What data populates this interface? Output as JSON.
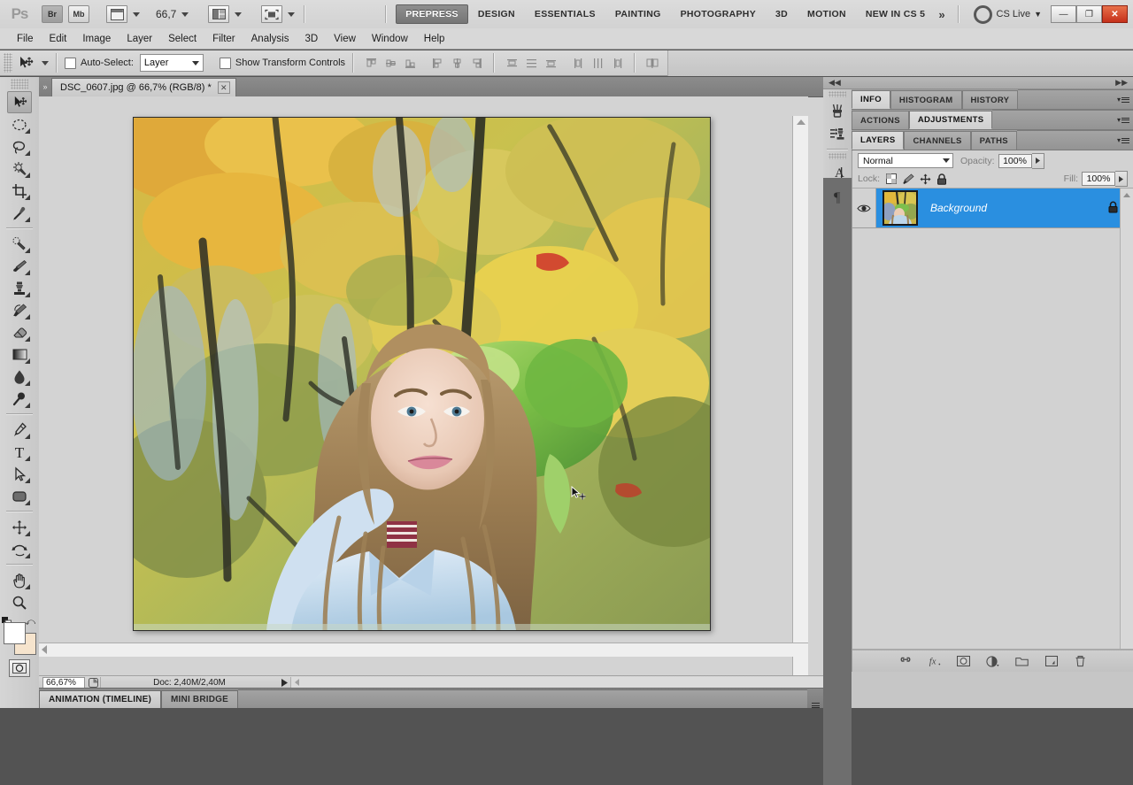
{
  "app": {
    "name": "Ps",
    "zoom_level": "66,7",
    "cs_live_label": "CS Live",
    "window_buttons": {
      "minimize": "—",
      "restore": "❐",
      "close": "✕"
    },
    "launchers": [
      {
        "name": "bridge-button",
        "label": "Br"
      },
      {
        "name": "mini-bridge-button",
        "label": "Mb"
      }
    ],
    "workspaces": [
      {
        "label": "PREPRESS",
        "active": true
      },
      {
        "label": "DESIGN",
        "active": false
      },
      {
        "label": "ESSENTIALS",
        "active": false
      },
      {
        "label": "PAINTING",
        "active": false
      },
      {
        "label": "PHOTOGRAPHY",
        "active": false
      },
      {
        "label": "3D",
        "active": false
      },
      {
        "label": "MOTION",
        "active": false
      },
      {
        "label": "NEW IN CS 5",
        "active": false
      }
    ],
    "workspace_overflow": "»"
  },
  "menubar": {
    "items": [
      "File",
      "Edit",
      "Image",
      "Layer",
      "Select",
      "Filter",
      "Analysis",
      "3D",
      "View",
      "Window",
      "Help"
    ]
  },
  "options_bar": {
    "tool": "move-tool",
    "auto_select_label": "Auto-Select:",
    "auto_select_checked": false,
    "auto_select_value": "Layer",
    "show_transform_label": "Show Transform Controls",
    "show_transform_checked": false,
    "align_buttons": [
      "align-top-edges",
      "align-vertical-centers",
      "align-bottom-edges",
      "align-left-edges",
      "align-horizontal-centers",
      "align-right-edges"
    ],
    "distribute_buttons": [
      "distribute-top-edges",
      "distribute-vertical-centers",
      "distribute-bottom-edges",
      "distribute-left-edges",
      "distribute-horizontal-centers",
      "distribute-right-edges"
    ],
    "auto_align_button": "auto-align-layers"
  },
  "toolbar": {
    "tools": [
      {
        "name": "move-tool",
        "selected": true,
        "has_flyout": false
      },
      {
        "name": "elliptical-marquee-tool",
        "selected": false,
        "has_flyout": true
      },
      {
        "name": "lasso-tool",
        "selected": false,
        "has_flyout": true
      },
      {
        "name": "quick-selection-tool",
        "selected": false,
        "has_flyout": true
      },
      {
        "name": "crop-tool",
        "selected": false,
        "has_flyout": true
      },
      {
        "name": "eyedropper-tool",
        "selected": false,
        "has_flyout": true
      },
      {
        "name": "spot-healing-brush-tool",
        "selected": false,
        "has_flyout": true
      },
      {
        "name": "brush-tool",
        "selected": false,
        "has_flyout": true
      },
      {
        "name": "clone-stamp-tool",
        "selected": false,
        "has_flyout": true
      },
      {
        "name": "history-brush-tool",
        "selected": false,
        "has_flyout": true
      },
      {
        "name": "eraser-tool",
        "selected": false,
        "has_flyout": true
      },
      {
        "name": "gradient-tool",
        "selected": false,
        "has_flyout": true
      },
      {
        "name": "blur-tool",
        "selected": false,
        "has_flyout": true
      },
      {
        "name": "dodge-tool",
        "selected": false,
        "has_flyout": true
      },
      {
        "name": "pen-tool",
        "selected": false,
        "has_flyout": true
      },
      {
        "name": "horizontal-type-tool",
        "selected": false,
        "has_flyout": true
      },
      {
        "name": "path-selection-tool",
        "selected": false,
        "has_flyout": true
      },
      {
        "name": "rounded-rectangle-tool",
        "selected": false,
        "has_flyout": true
      },
      {
        "name": "3d-object-rotate-tool",
        "selected": false,
        "has_flyout": true
      },
      {
        "name": "3d-camera-rotate-tool",
        "selected": false,
        "has_flyout": true
      },
      {
        "name": "hand-tool",
        "selected": false,
        "has_flyout": true
      },
      {
        "name": "zoom-tool",
        "selected": false,
        "has_flyout": false
      }
    ],
    "foreground_color": "#ffffff",
    "background_color": "#f6e4cd",
    "quick_mask_name": "edit-in-quick-mask-mode"
  },
  "document": {
    "tab_title": "DSC_0607.jpg @ 66,7% (RGB/8) *",
    "close_glyph": "✕",
    "status_zoom": "66,67%",
    "doc_size": "Doc: 2,40M/2,40M",
    "canvas_description": "oil-paint filtered photo of a smiling young woman wearing a crown of green leaves, standing among golden autumn foliage and dark tree trunks, wearing a light blue shirt"
  },
  "bottom_tabs": [
    {
      "label": "ANIMATION (TIMELINE)",
      "active": true
    },
    {
      "label": "MINI BRIDGE",
      "active": false
    }
  ],
  "right_dock": {
    "icon_dock": [
      {
        "name": "brush-panel-icon"
      },
      {
        "name": "clone-source-panel-icon"
      },
      {
        "name": "character-panel-icon",
        "glyph": "A"
      },
      {
        "name": "paragraph-panel-icon",
        "glyph": "¶"
      }
    ],
    "group_info": {
      "tabs": [
        {
          "label": "INFO",
          "active": true
        },
        {
          "label": "HISTOGRAM",
          "active": false
        },
        {
          "label": "HISTORY",
          "active": false
        }
      ]
    },
    "group_adjustments": {
      "tabs": [
        {
          "label": "ACTIONS",
          "active": false
        },
        {
          "label": "ADJUSTMENTS",
          "active": true
        }
      ]
    },
    "group_layers": {
      "tabs": [
        {
          "label": "LAYERS",
          "active": true
        },
        {
          "label": "CHANNELS",
          "active": false
        },
        {
          "label": "PATHS",
          "active": false
        }
      ],
      "blend_mode": "Normal",
      "opacity_label": "Opacity:",
      "opacity_value": "100%",
      "lock_label": "Lock:",
      "lock_buttons": [
        "lock-transparent-pixels",
        "lock-image-pixels",
        "lock-position",
        "lock-all"
      ],
      "fill_label": "Fill:",
      "fill_value": "100%",
      "layers": [
        {
          "name": "Background",
          "visible": true,
          "locked": true,
          "selected": true
        }
      ],
      "footer_buttons": [
        "link-layers-icon",
        "add-layer-style-icon",
        "add-layer-mask-icon",
        "new-adjustment-layer-icon",
        "new-group-icon",
        "new-layer-icon",
        "delete-layer-icon"
      ]
    }
  },
  "colors": {
    "accent_selected_layer": "#2a8fe0",
    "workspace_active_bg": "#7d7d7d",
    "close_button": "#c5301a",
    "chrome_light": "#d8d8d8",
    "canvas_bg": "#d3d3d3"
  }
}
